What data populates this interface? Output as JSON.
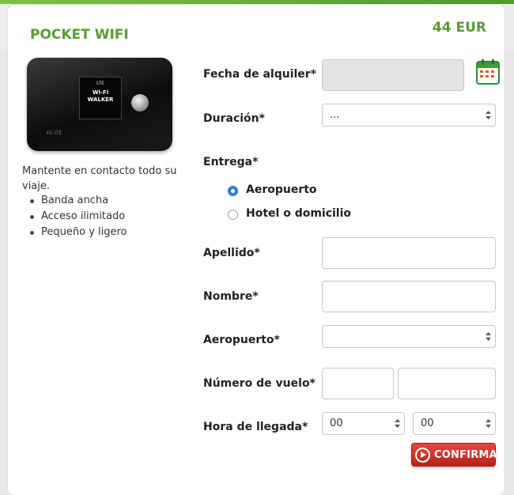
{
  "product": {
    "title": "POCKET WIFI",
    "price": "44 EUR",
    "description": "Mantente en contacto todo su viaje.",
    "features": [
      "Banda ancha",
      "Acceso ilimitado",
      "Pequeño y ligero"
    ],
    "device_screen": {
      "status": "LTE",
      "brand_line1": "Wi-Fi",
      "brand_line2": "WALKER",
      "tag": "4G LTE"
    }
  },
  "form": {
    "rental_date": {
      "label": "Fecha de alquiler*",
      "value": ""
    },
    "duration": {
      "label": "Duración*",
      "value": "..."
    },
    "delivery": {
      "label": "Entrega*",
      "options": [
        {
          "label": "Aeropuerto",
          "checked": true
        },
        {
          "label": "Hotel o domicilio",
          "checked": false
        }
      ]
    },
    "surname": {
      "label": "Apellido*",
      "value": ""
    },
    "first_name": {
      "label": "Nombre*",
      "value": ""
    },
    "airport": {
      "label": "Aeropuerto*",
      "value": ""
    },
    "flight_number": {
      "label": "Número de vuelo*",
      "value_1": "",
      "value_2": ""
    },
    "arrival_time": {
      "label": "Hora de llegada*",
      "hour": "00",
      "minute": "00"
    },
    "confirm_label": "CONFIRMAR"
  },
  "colors": {
    "brand_green": "#5a9a35",
    "calendar_green": "#2f8a3a",
    "confirm_red": "#d0352b",
    "radio_blue": "#2a7fd8"
  }
}
